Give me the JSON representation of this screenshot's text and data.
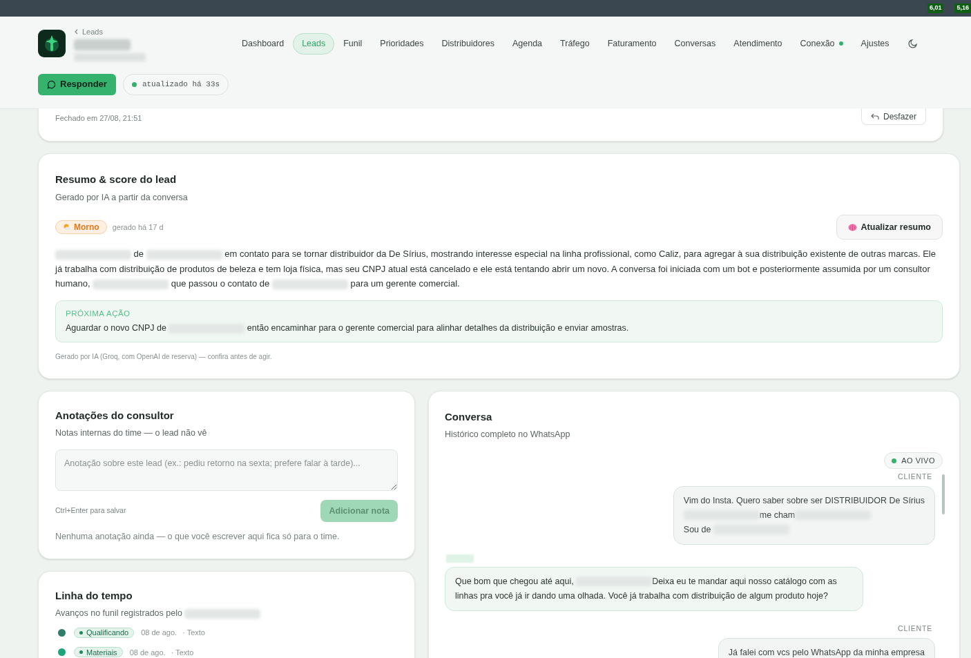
{
  "browser_bar": {
    "badges": [
      "6,01",
      "5,16"
    ]
  },
  "header": {
    "breadcrumb": "Leads",
    "reply_button": "Responder",
    "sync_status": "atualizado há 33s",
    "nav": [
      {
        "label": "Dashboard",
        "selected": false
      },
      {
        "label": "Leads",
        "selected": true
      },
      {
        "label": "Funil",
        "selected": false
      },
      {
        "label": "Prioridades",
        "selected": false
      },
      {
        "label": "Distribuidores",
        "selected": false
      },
      {
        "label": "Agenda",
        "selected": false
      },
      {
        "label": "Tráfego",
        "selected": false
      },
      {
        "label": "Faturamento",
        "selected": false
      },
      {
        "label": "Conversas",
        "selected": false
      },
      {
        "label": "Atendimento",
        "selected": false
      },
      {
        "label": "Conexão",
        "selected": false,
        "online": true
      },
      {
        "label": "Ajustes",
        "selected": false
      }
    ]
  },
  "closed_card": {
    "text": "Fechado em 27/08, 21:51",
    "undo_button": "Desfazer"
  },
  "summary": {
    "title": "Resumo & score do lead",
    "subtitle": "Gerado por IA a partir da conversa",
    "temperature": "Morno",
    "generated": "gerado há 17 d",
    "refresh_button": "Atualizar resumo",
    "text": [
      {
        "kind": "redacted"
      },
      {
        "kind": "text",
        "text": " de "
      },
      {
        "kind": "redacted"
      },
      {
        "kind": "text",
        "text": " em contato para se tornar distribuidor da De Sírius, mostrando interesse especial na linha profissional, como Caliz, para agregar à sua distribuição existente de outras marcas. Ele já trabalha com distribuição de produtos de beleza e tem loja física, mas seu CNPJ atual está cancelado e ele está tentando abrir um novo. A conversa foi iniciada com um bot e posteriormente assumida por um consultor humano, "
      },
      {
        "kind": "redacted"
      },
      {
        "kind": "text",
        "text": " que passou o contato de "
      },
      {
        "kind": "redacted"
      },
      {
        "kind": "text",
        "text": " para um gerente comercial."
      }
    ],
    "next_action": {
      "label": "PRÓXIMA AÇÃO",
      "text": [
        {
          "kind": "text",
          "text": "Aguardar o novo CNPJ de "
        },
        {
          "kind": "redacted"
        },
        {
          "kind": "text",
          "text": " então encaminhar para o gerente comercial para alinhar detalhes da distribuição e enviar amostras."
        }
      ]
    },
    "footnote": "Gerado por IA (Groq, com OpenAI de reserva) — confira antes de agir."
  },
  "notes": {
    "title": "Anotações do consultor",
    "subtitle": "Notas internas do time — o lead não vê",
    "placeholder": "Anotação sobre este lead (ex.: pediu retorno na sexta; prefere falar à tarde)...",
    "hint": "Ctrl+Enter para salvar",
    "add_button": "Adicionar nota",
    "add_disabled": true,
    "empty": "Nenhuma anotação ainda — o que você escrever aqui fica só para o time."
  },
  "timeline": {
    "title": "Linha do tempo",
    "subtitle": [
      {
        "kind": "text",
        "text": "Avanços no funil registrados pelo "
      },
      {
        "kind": "redacted"
      }
    ],
    "events": [
      {
        "stage": "Qualificando",
        "date": "08 de ago.",
        "type": "· Texto",
        "color": "#2f7d6a"
      },
      {
        "stage": "Materiais",
        "date": "08 de ago.",
        "type": "· Texto",
        "color": "#1fa37a"
      }
    ]
  },
  "conversation": {
    "title": "Conversa",
    "subtitle": "Histórico completo no WhatsApp",
    "live_badge": "AO VIVO",
    "messages": [
      {
        "kind": "client",
        "label": "CLIENTE",
        "lines": [
          [
            {
              "kind": "text",
              "text": "Vim do Insta. Quero saber sobre ser DISTRIBUIDOR De Sírius"
            }
          ],
          [
            {
              "kind": "redacted"
            },
            {
              "kind": "text",
              "text": "me cham"
            },
            {
              "kind": "redacted"
            }
          ],
          [
            {
              "kind": "text",
              "text": "Sou de "
            },
            {
              "kind": "redacted"
            }
          ]
        ]
      },
      {
        "kind": "agent",
        "lines": [
          [
            {
              "kind": "text",
              "text": "Que bom que chegou até aqui, "
            },
            {
              "kind": "redacted"
            },
            {
              "kind": "text",
              "text": "Deixa eu te mandar aqui nosso catálogo com as linhas pra você já ir dando uma olhada. Você já trabalha com distribuição de algum produto hoje?"
            }
          ]
        ]
      },
      {
        "kind": "client",
        "label": "CLIENTE",
        "lines": [
          [
            {
              "kind": "text",
              "text": "Já falei com vcs pelo WhatsApp da minha empresa"
            }
          ]
        ]
      }
    ]
  }
}
